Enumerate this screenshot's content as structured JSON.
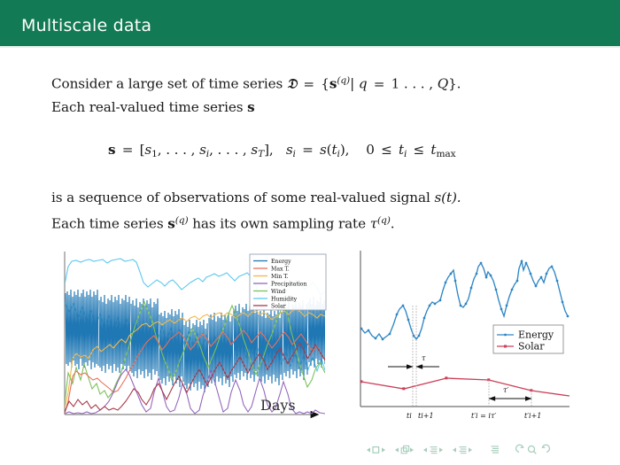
{
  "slide": {
    "title": "Multiscale data",
    "theme_accent": "#127A54",
    "background": "#ffffff"
  },
  "body": {
    "line1_plain": "Consider a large set of time series ℑ = {s^(q)| q = 1 ..., Q}.",
    "line2_plain": "Each real-valued time series s",
    "equation_plain": "s = [s₁, ..., sᵢ, ..., s_T],  sᵢ = s(tᵢ),   0 ≤ tᵢ ≤ t_max",
    "line3_plain": "is a sequence of observations of some real-valued signal s(t).",
    "line4_plain": "Each time series s^(q) has its own sampling rate τ^(q).",
    "tokens": {
      "consider": "Consider a large set of time series",
      "frak_d": "𝔇",
      "eq": "=",
      "brace_open": "{",
      "bold_s": "s",
      "sup_q": "(q)",
      "bar": "|",
      "q": "q",
      "one_dots": "1 . . . ,",
      "cap_q": "Q",
      "brace_close": "}.",
      "each_real": "Each real-valued time series",
      "is_sequence": "is a sequence of observations of some real-valued signal",
      "s_of_t": "s(t).",
      "each_ts": "Each time series",
      "has_own": "has its own sampling rate",
      "tau_sup_q": "τ",
      "period": "."
    },
    "equation": {
      "lhs": "s",
      "eq1": "=",
      "vector": "[s1, . . . , si, . . . , sT ],",
      "mid": "si = s(ti),",
      "range": "0 ≤ ti ≤ tmax"
    }
  },
  "chart_data": [
    {
      "id": "left-multivariate-timeseries",
      "type": "line",
      "title": "",
      "xlabel": "Days",
      "ylabel": "",
      "grid": false,
      "legend_position": "top-right",
      "axis_arrow": true,
      "series": [
        {
          "name": "Energy",
          "color": "#1f77b4",
          "sampling": "high-frequency-spiky"
        },
        {
          "name": "Max T.",
          "color": "#e8705a",
          "sampling": "daily"
        },
        {
          "name": "Min T.",
          "color": "#f2b84b",
          "sampling": "daily"
        },
        {
          "name": "Precipitation",
          "color": "#9467bd",
          "sampling": "daily"
        },
        {
          "name": "Wind",
          "color": "#7cc15a",
          "sampling": "daily"
        },
        {
          "name": "Humidity",
          "color": "#5bc8ee",
          "sampling": "daily"
        },
        {
          "name": "Solar",
          "color": "#a83a4a",
          "sampling": "daily"
        }
      ]
    },
    {
      "id": "right-sampling-rate-zoom",
      "type": "line",
      "title": "",
      "xlabel": "",
      "ylabel": "",
      "grid": false,
      "legend_position": "center-right",
      "series": [
        {
          "name": "Energy",
          "color": "#2f86c5",
          "marker": "dot",
          "sampling_symbol": "τ"
        },
        {
          "name": "Solar",
          "color": "#cc3f58",
          "marker": "square",
          "sampling_symbol": "τ′"
        }
      ],
      "annotations": [
        {
          "name": "tau",
          "label": "τ",
          "between": [
            "t_i",
            "t_{i+1}"
          ]
        },
        {
          "name": "tau-prime",
          "label": "τ′",
          "between": [
            "t'_i",
            "t'_{i+1}"
          ]
        }
      ],
      "xtick_labels": [
        "ti",
        "ti+1",
        "t′i = iτ′",
        "t′i+1"
      ]
    }
  ],
  "nav": {
    "items": [
      {
        "name": "nav-slide",
        "glyph": "□"
      },
      {
        "name": "nav-frame",
        "glyph": "❐"
      },
      {
        "name": "nav-subsection",
        "glyph": "≡"
      },
      {
        "name": "nav-section",
        "glyph": "≡"
      },
      {
        "name": "nav-toc",
        "glyph": "≡"
      },
      {
        "name": "nav-back",
        "glyph": "↺"
      },
      {
        "name": "nav-search",
        "glyph": "🔍"
      },
      {
        "name": "nav-forward",
        "glyph": "↻"
      }
    ],
    "color": "#a7cdbb"
  }
}
